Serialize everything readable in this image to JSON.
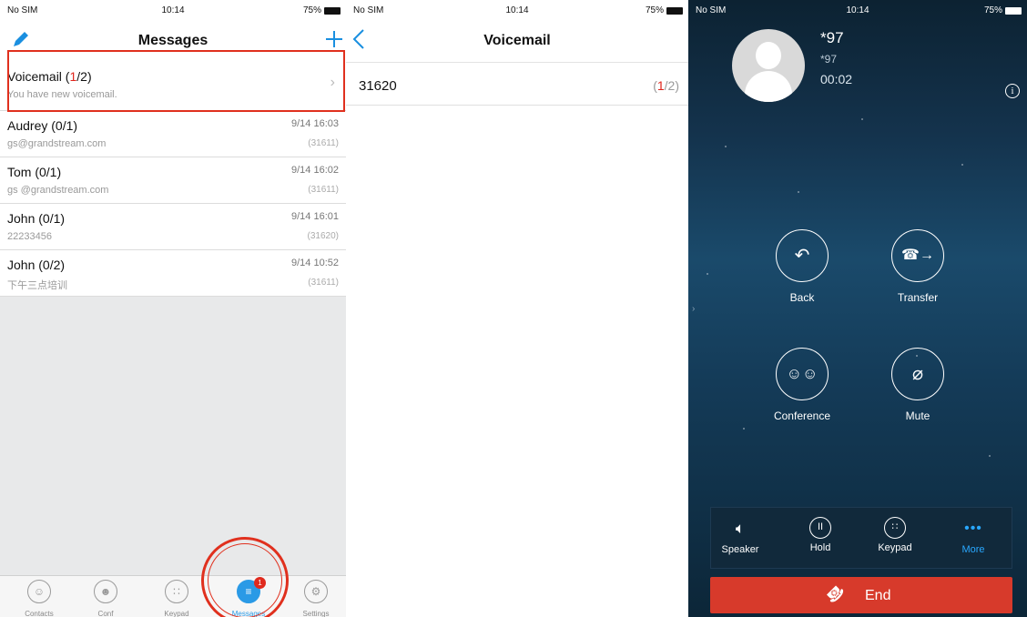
{
  "status_bars": [
    {
      "carrier": "No SIM",
      "time": "10:14",
      "battery": "75%"
    },
    {
      "carrier": "No SIM",
      "time": "10:14",
      "battery": "75%"
    },
    {
      "carrier": "No SIM",
      "time": "10:14",
      "battery": "75%"
    }
  ],
  "messages": {
    "title": "Messages",
    "edit_icon": "pencil-icon",
    "add_icon": "plus-icon",
    "voicemail": {
      "label": "Voicemail (",
      "new_count": "1",
      "rest": "/2)",
      "sub": "You have new voicemail."
    },
    "rows": [
      {
        "title": "Audrey  (0/1)",
        "sub": "gs@grandstream.com",
        "time": "9/14 16:03",
        "ext": "(31611)"
      },
      {
        "title": "Tom  (0/1)",
        "sub": "gs @grandstream.com",
        "time": "9/14 16:02",
        "ext": "(31611)"
      },
      {
        "title": "John  (0/1)",
        "sub": "22233456",
        "time": "9/14 16:01",
        "ext": "(31620)"
      },
      {
        "title": "John  (0/2)",
        "sub": "下午三点培训",
        "time": "9/14 10:52",
        "ext": "(31611)"
      }
    ],
    "tabs": [
      {
        "label": "Contacts",
        "icon": "contacts-icon"
      },
      {
        "label": "Conf",
        "icon": "conference-icon"
      },
      {
        "label": "Keypad",
        "icon": "keypad-icon"
      },
      {
        "label": "Messages",
        "icon": "messages-icon",
        "badge": "1"
      },
      {
        "label": "Settings",
        "icon": "gear-icon"
      }
    ]
  },
  "voicemail": {
    "title": "Voicemail",
    "back_icon": "chevron-left-icon",
    "item": {
      "number": "31620",
      "count_new": "1",
      "count_total": "/2)",
      "count_open": "("
    }
  },
  "call": {
    "name": "*97",
    "number": "*97",
    "duration": "00:02",
    "buttons": [
      {
        "label": "Back",
        "icon": "back-arrow-icon"
      },
      {
        "label": "Transfer",
        "icon": "transfer-icon"
      },
      {
        "label": "Conference",
        "icon": "conference-icon"
      },
      {
        "label": "Mute",
        "icon": "mute-icon"
      }
    ],
    "bottom": [
      {
        "label": "Speaker",
        "icon": "speaker-icon"
      },
      {
        "label": "Hold",
        "icon": "pause-icon"
      },
      {
        "label": "Keypad",
        "icon": "keypad-icon"
      },
      {
        "label": "More",
        "icon": "more-dots-icon"
      }
    ],
    "end_label": "End",
    "colors": {
      "end": "#d73a2b",
      "accent": "#29a8ff"
    }
  }
}
